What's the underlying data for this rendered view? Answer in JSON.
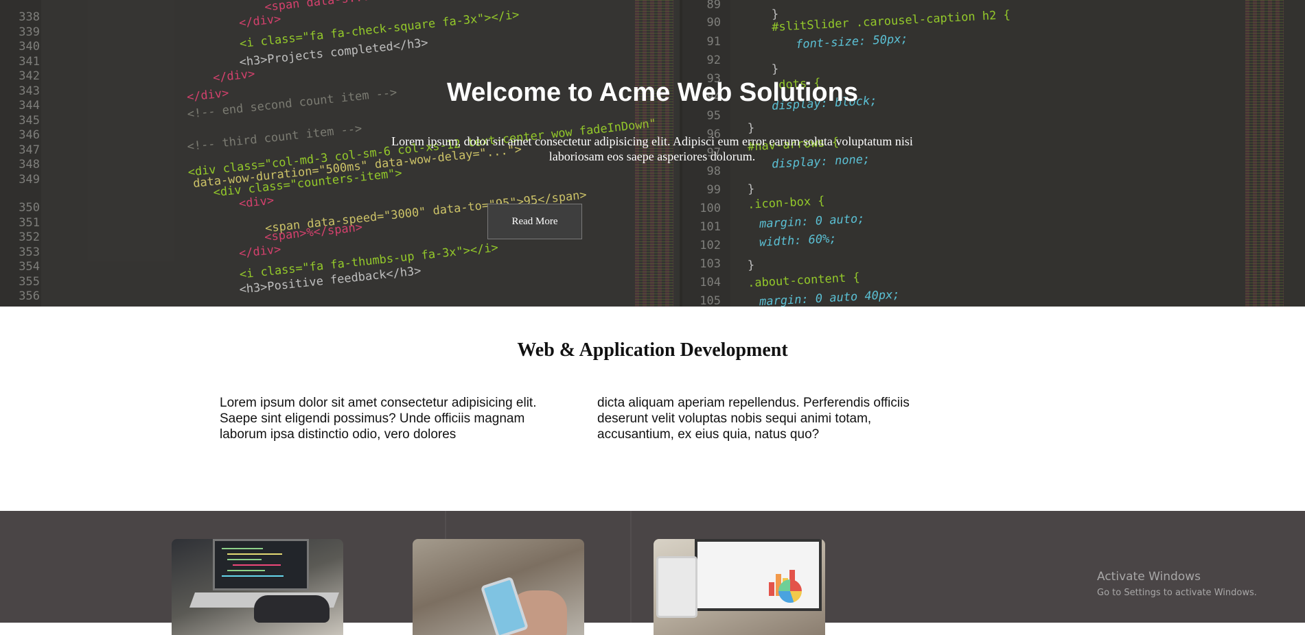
{
  "hero": {
    "title": "Welcome to Acme Web Solutions",
    "subtitle": "Lorem ipsum, dolor sit amet consectetur adipisicing elit. Adipisci eum error earum soluta voluptatum nisi laboriosam eos saepe asperiores dolorum.",
    "button_label": "Read More"
  },
  "code_left": {
    "line_numbers": [
      "338",
      "339",
      "340",
      "341",
      "342",
      "343",
      "344",
      "345",
      "346",
      "347",
      "348",
      "349",
      "350",
      "351",
      "352",
      "353",
      "354",
      "355",
      "356"
    ],
    "lines": [
      "<span data-s...",
      "</div>",
      "<i class=\"fa fa-check-square fa-3x\"></i>",
      "<h3>Projects completed</h3>",
      "</div>",
      "</div>",
      "<!-- end second count item -->",
      "<!-- third count item -->",
      "<div class=\"col-md-3 col-sm-6 col-xs-12 text-center wow fadeInDown\"",
      "data-wow-duration=\"500ms\" data-wow-delay=\"...\">",
      "<div class=\"counters-item\">",
      "<div>",
      "<span data-speed=\"3000\" data-to=\"95\">95</span>",
      "<span>%</span>",
      "</div>",
      "<i class=\"fa fa-thumbs-up fa-3x\"></i>",
      "<h3>Positive feedback</h3>"
    ]
  },
  "code_right": {
    "line_numbers": [
      "89",
      "90",
      "91",
      "92",
      "93",
      "94",
      "95",
      "96",
      "97",
      "98",
      "99",
      "100",
      "101",
      "102",
      "103",
      "104",
      "105"
    ],
    "lines": [
      "}",
      "#slitSlider .carousel-caption h2 {",
      "font-size: 50px;",
      "}",
      ".dots {",
      "display: block;",
      "}",
      "#nav-arrows {",
      "display: none;",
      "}",
      ".icon-box {",
      "margin: 0 auto;",
      "width: 60%;",
      "}",
      ".about-content {",
      "margin: 0 auto 40px;"
    ]
  },
  "development": {
    "title": "Web & Application Development",
    "column_1": "Lorem ipsum dolor sit amet consectetur adipisicing elit. Saepe sint eligendi possimus? Unde officiis magnam laborum ipsa distinctio odio, vero dolores",
    "column_2": "dicta aliquam aperiam repellendus. Perferendis officiis deserunt velit voluptas nobis sequi animi totam, accusantium, ex eius quia, natus quo?"
  },
  "cards": [
    {
      "image": "laptop-coding-photo"
    },
    {
      "image": "smartphone-in-hand-photo"
    },
    {
      "image": "laptop-charts-photo"
    }
  ],
  "watermark": {
    "line1": "Activate Windows",
    "line2": "Go to Settings to activate Windows."
  },
  "colors": {
    "hero_bg": "#3a3936",
    "cards_bg": "#4a4546",
    "button_bg": "#3e3e3e"
  }
}
